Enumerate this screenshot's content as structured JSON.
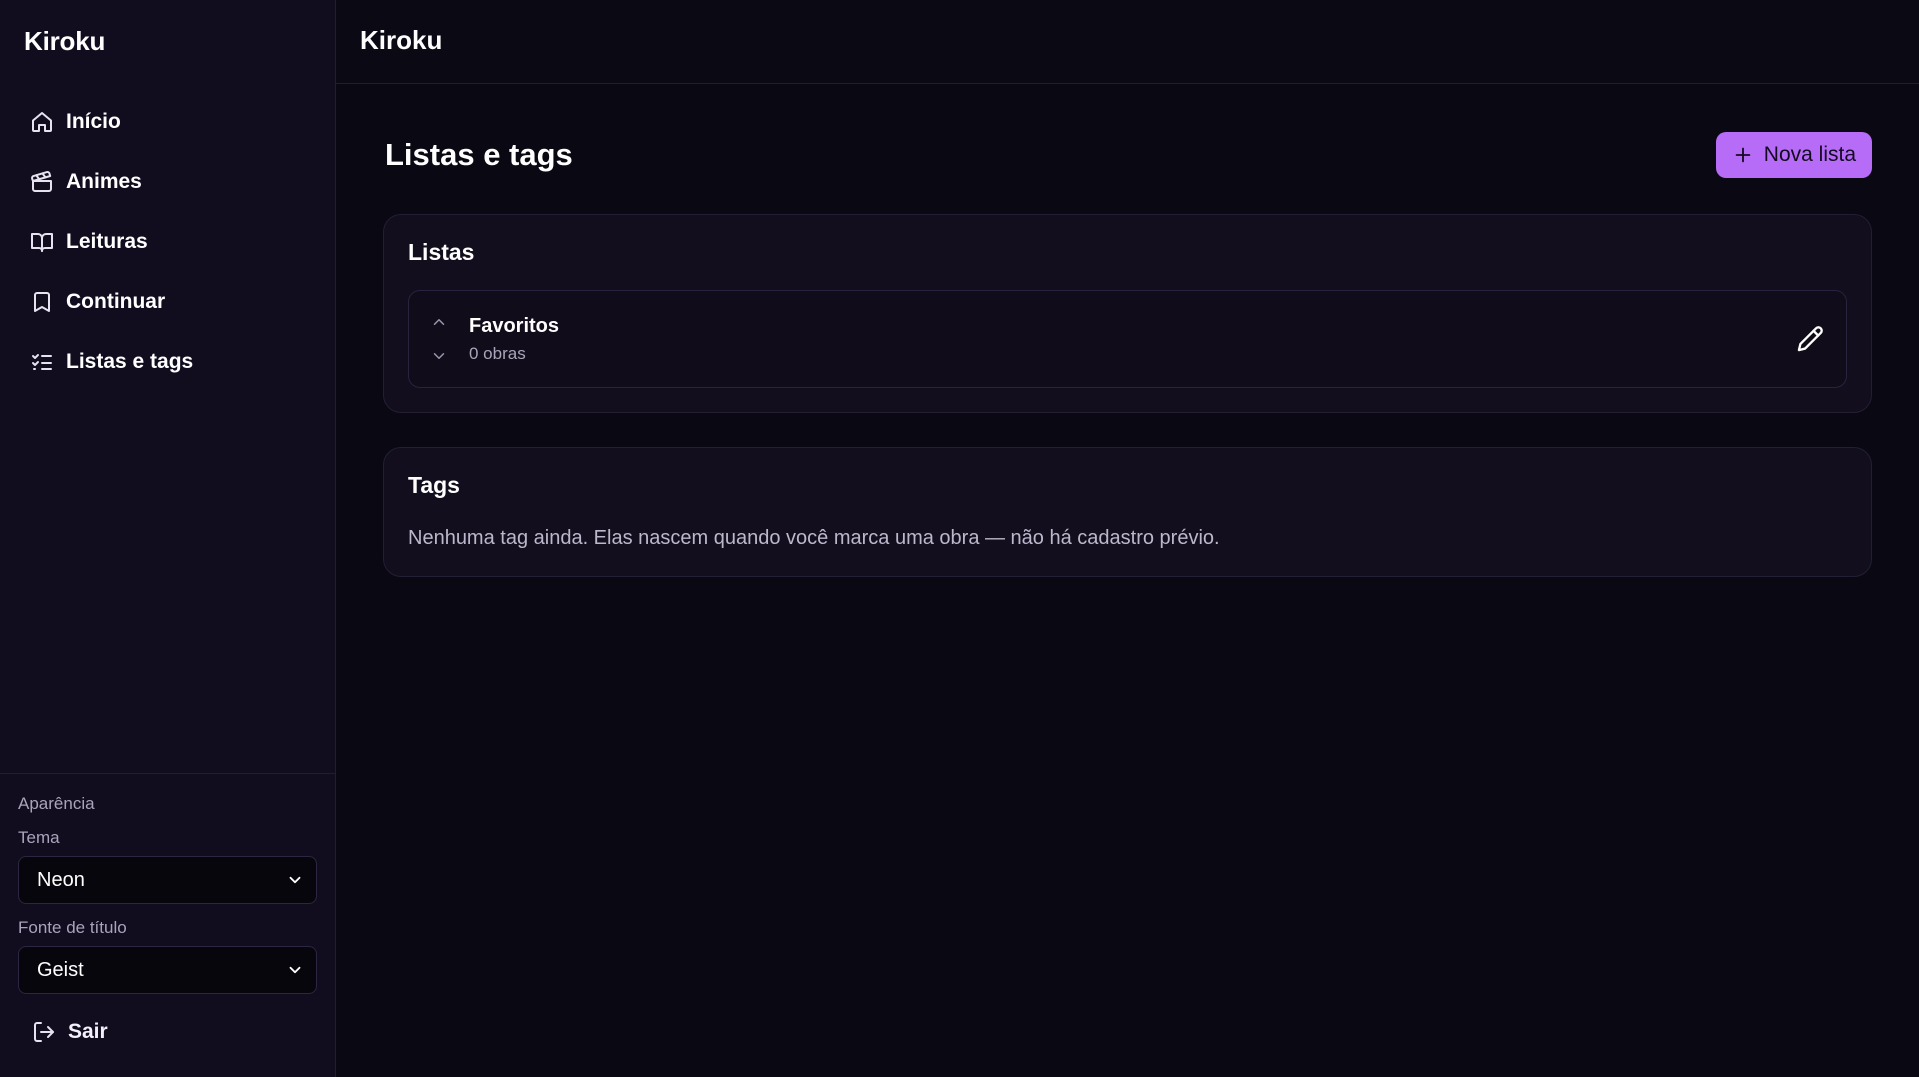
{
  "app": {
    "brand": "Kiroku"
  },
  "sidebar": {
    "items": [
      {
        "label": "Início",
        "icon": "home-icon"
      },
      {
        "label": "Animes",
        "icon": "clapperboard-icon"
      },
      {
        "label": "Leituras",
        "icon": "book-open-icon"
      },
      {
        "label": "Continuar",
        "icon": "bookmark-icon"
      },
      {
        "label": "Listas e tags",
        "icon": "list-checks-icon"
      }
    ],
    "appearance": {
      "section_label": "Aparência",
      "theme_label": "Tema",
      "theme_value": "Neon",
      "title_font_label": "Fonte de título",
      "title_font_value": "Geist"
    },
    "logout_label": "Sair"
  },
  "topbar": {
    "title": "Kiroku"
  },
  "page": {
    "title": "Listas e tags",
    "new_list_label": "Nova lista"
  },
  "lists_card": {
    "title": "Listas",
    "items": [
      {
        "name": "Favoritos",
        "count": "0 obras"
      }
    ]
  },
  "tags_card": {
    "title": "Tags",
    "empty_message": "Nenhuma tag ainda. Elas nascem quando você marca uma obra — não há cadastro prévio."
  },
  "colors": {
    "accent": "#b66cf6",
    "background": "#0a0812",
    "sidebar": "#110c1e",
    "card": "#120e1d"
  }
}
